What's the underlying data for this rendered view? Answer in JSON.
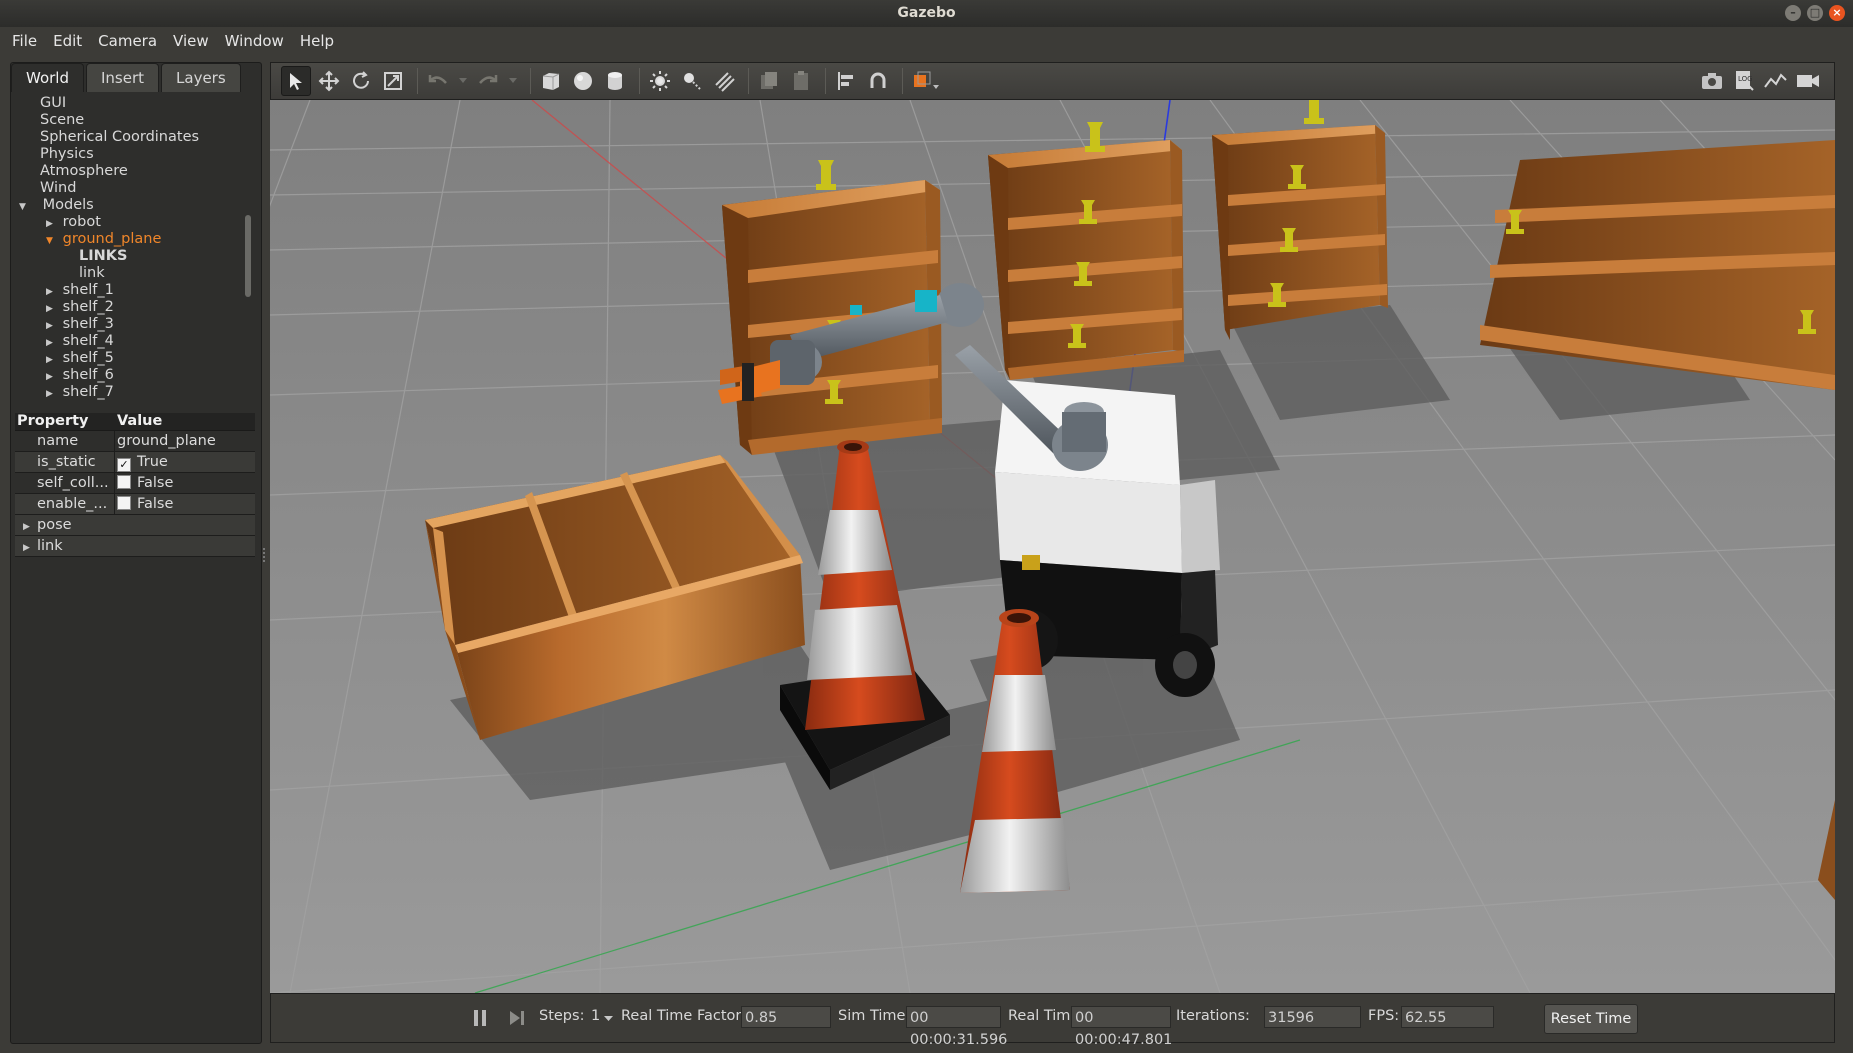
{
  "window": {
    "title": "Gazebo",
    "buttons": [
      "–",
      "□",
      "×"
    ]
  },
  "menu": [
    {
      "label": "File"
    },
    {
      "label": "Edit"
    },
    {
      "label": "Camera"
    },
    {
      "label": "View"
    },
    {
      "label": "Window"
    },
    {
      "label": "Help"
    }
  ],
  "left_panel": {
    "tabs": [
      {
        "label": "World"
      },
      {
        "label": "Insert"
      },
      {
        "label": "Layers"
      }
    ],
    "tree": {
      "gui": "GUI",
      "scene": "Scene",
      "spherical": "Spherical Coordinates",
      "physics": "Physics",
      "atmosphere": "Atmosphere",
      "wind": "Wind",
      "models": "Models",
      "robot": "robot",
      "ground_plane": "ground_plane",
      "links_header": "LINKS",
      "link": "link",
      "shelves": [
        "shelf_1",
        "shelf_2",
        "shelf_3",
        "shelf_4",
        "shelf_5",
        "shelf_6",
        "shelf_7"
      ]
    },
    "properties": {
      "header": {
        "property": "Property",
        "value": "Value"
      },
      "rows": [
        {
          "name": "name",
          "value": "ground_plane",
          "checkbox": false
        },
        {
          "name": "is_static",
          "value": "True",
          "checkbox": true,
          "checked": true
        },
        {
          "name": "self_coll...",
          "value": "False",
          "checkbox": true,
          "checked": false
        },
        {
          "name": "enable_...",
          "value": "False",
          "checkbox": true,
          "checked": false
        }
      ],
      "groups": [
        "pose",
        "link"
      ]
    }
  },
  "toolbar": {
    "icons": [
      "select-icon",
      "translate-icon",
      "rotate-icon",
      "scale-icon",
      "undo-icon",
      "redo-icon",
      "box-icon",
      "sphere-icon",
      "cylinder-icon",
      "point-light-icon",
      "spot-light-icon",
      "directional-light-icon",
      "copy-icon",
      "paste-icon",
      "align-icon",
      "snap-icon",
      "view-angle-icon",
      "screenshot-icon",
      "log-icon",
      "plot-icon",
      "record-icon"
    ]
  },
  "status": {
    "steps_label": "Steps:",
    "steps_value": "1",
    "rtf_label": "Real Time Factor:",
    "rtf_value": "0.85",
    "sim_time_label": "Sim Time:",
    "sim_time_value": "00 00:00:31.596",
    "real_time_label": "Real Time:",
    "real_time_value": "00 00:00:47.801",
    "iterations_label": "Iterations:",
    "iterations_value": "31596",
    "fps_label": "FPS:",
    "fps_value": "62.55",
    "reset_label": "Reset Time"
  },
  "colors": {
    "accent": "#f0862a",
    "ground": "#8e8e8e",
    "wood": "#b56a2a",
    "cone_orange": "#d2451a",
    "cup_yellow": "#c9c21a"
  }
}
